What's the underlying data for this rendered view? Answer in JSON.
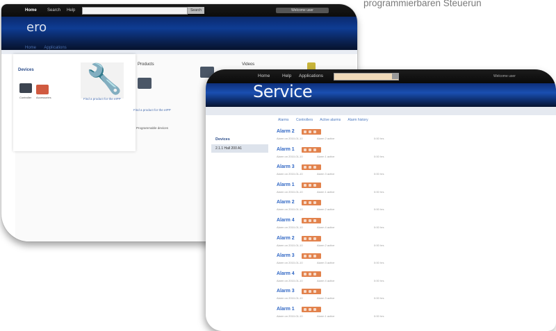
{
  "caption": "programmierbaren Steuerun",
  "back_window": {
    "nav": [
      "Home",
      "Search",
      "Help"
    ],
    "search_button": "Search",
    "right_box": "Welcome user",
    "logo": "ero",
    "breadcrumbs": [
      "Home",
      "Applications"
    ],
    "panel_title": "Devices",
    "thumb_labels": [
      "Controller",
      "Accessories"
    ],
    "panel_link": "Find a product for the eIPP",
    "col_titles": [
      "Products",
      "Videos"
    ],
    "col_link": "Find a product for the eIPP",
    "section_text": "Programmable devices"
  },
  "front_window": {
    "nav": [
      "Home",
      "Help",
      "Applications"
    ],
    "right_text": "Welcome user",
    "logo": "Service",
    "tabs": [
      "Alarms",
      "Controllers",
      "Active alarms",
      "Alarm history"
    ],
    "side_title": "Devices",
    "side_item": "2.1.1 Hall 200 A1",
    "alarms": [
      {
        "name": "Alarm 2",
        "d1": "Alarm on 2010-01-10",
        "d2": "Alarm 2 active",
        "d3": "0:00 hrs"
      },
      {
        "name": "Alarm 1",
        "d1": "Alarm on 2010-01-10",
        "d2": "Alarm 1 active",
        "d3": "0:00 hrs"
      },
      {
        "name": "Alarm 3",
        "d1": "Alarm on 2010-01-10",
        "d2": "Alarm 3 active",
        "d3": "0:00 hrs"
      },
      {
        "name": "Alarm 1",
        "d1": "Alarm on 2010-01-10",
        "d2": "Alarm 1 active",
        "d3": "0:00 hrs"
      },
      {
        "name": "Alarm 2",
        "d1": "Alarm on 2010-01-10",
        "d2": "Alarm 2 active",
        "d3": "0:00 hrs"
      },
      {
        "name": "Alarm 4",
        "d1": "Alarm on 2010-01-10",
        "d2": "Alarm 4 active",
        "d3": "0:00 hrs"
      },
      {
        "name": "Alarm 2",
        "d1": "Alarm on 2010-01-10",
        "d2": "Alarm 2 active",
        "d3": "0:00 hrs"
      },
      {
        "name": "Alarm 3",
        "d1": "Alarm on 2010-01-10",
        "d2": "Alarm 3 active",
        "d3": "0:00 hrs"
      },
      {
        "name": "Alarm 4",
        "d1": "Alarm on 2010-01-10",
        "d2": "Alarm 4 active",
        "d3": "0:00 hrs"
      },
      {
        "name": "Alarm 3",
        "d1": "Alarm on 2010-01-10",
        "d2": "Alarm 3 active",
        "d3": "0:00 hrs"
      },
      {
        "name": "Alarm 1",
        "d1": "Alarm on 2010-01-10",
        "d2": "Alarm 1 active",
        "d3": "0:00 hrs"
      }
    ],
    "badge_color": "#e2824c"
  }
}
